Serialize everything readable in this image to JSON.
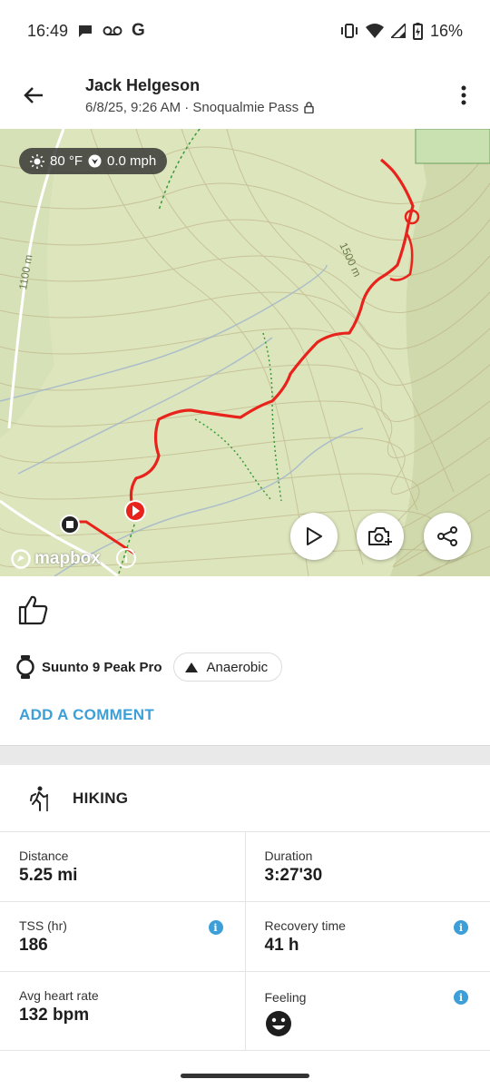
{
  "status_bar": {
    "time": "16:49",
    "left_icons": [
      "chat-bubble-icon",
      "voicemail-icon",
      "google-icon"
    ],
    "google_letter": "G",
    "right_icons": [
      "vibrate-icon",
      "wifi-icon",
      "signal-icon",
      "battery-charging-icon"
    ],
    "battery": "16%"
  },
  "header": {
    "name": "Jack Helgeson",
    "subtitle": "6/8/25, 9:26 AM · Snoqualmie Pass",
    "back_icon": "arrow-back-icon",
    "menu_icon": "more-vertical-icon"
  },
  "map": {
    "weather": {
      "temperature": "80 °F",
      "wind": "0.0 mph"
    },
    "elevation_labels": [
      "1500 m",
      "1100 m"
    ],
    "attribution": "mapbox",
    "buttons": [
      "play-icon",
      "add-photo-icon",
      "share-icon"
    ],
    "route_color": "#e8231c"
  },
  "social": {
    "like_icon": "thumbs-up-icon",
    "device": "Suunto 9 Peak Pro",
    "tag": "Anaerobic",
    "add_comment": "ADD A COMMENT",
    "accent": "#3d9fd8"
  },
  "activity": {
    "icon": "hiking-icon",
    "name": "HIKING"
  },
  "stats": [
    [
      {
        "label": "Distance",
        "value": "5.25 mi"
      },
      {
        "label": "Duration",
        "value": "3:27'30"
      }
    ],
    [
      {
        "label": "TSS (hr)",
        "value": "186",
        "info": "i"
      },
      {
        "label": "Recovery time",
        "value": "41 h",
        "info": "i"
      }
    ],
    [
      {
        "label": "Avg heart rate",
        "value": "132 bpm"
      },
      {
        "label": "Feeling",
        "value": "",
        "info": "i",
        "icon": "happy-face-icon"
      }
    ]
  ]
}
